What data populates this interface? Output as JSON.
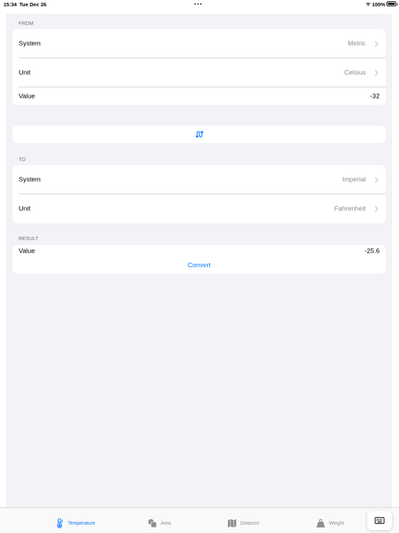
{
  "status_bar": {
    "time": "15:34",
    "date": "Tue Dec 26",
    "battery_percent": "100%",
    "battery_level": 1.0
  },
  "from": {
    "header": "FROM",
    "system_label": "System",
    "system_value": "Metric",
    "unit_label": "Unit",
    "unit_value": "Celsius",
    "value_label": "Value",
    "value": "-32"
  },
  "swap_icon": "swap-arrows-icon",
  "to": {
    "header": "TO",
    "system_label": "System",
    "system_value": "Imperial",
    "unit_label": "Unit",
    "unit_value": "Fahrenheit"
  },
  "result": {
    "header": "RESULT",
    "value_label": "Value",
    "value": "-25.6",
    "convert_label": "Convert"
  },
  "tabs": [
    {
      "label": "Temperature",
      "icon": "thermometer-icon",
      "active": true
    },
    {
      "label": "Area",
      "icon": "area-shapes-icon",
      "active": false
    },
    {
      "label": "Distance",
      "icon": "map-icon",
      "active": false
    },
    {
      "label": "Weight",
      "icon": "scale-weight-icon",
      "active": false
    }
  ],
  "colors": {
    "accent": "#0a7aff",
    "background": "#f2f2f7",
    "secondary_text": "#8a8a8e"
  }
}
